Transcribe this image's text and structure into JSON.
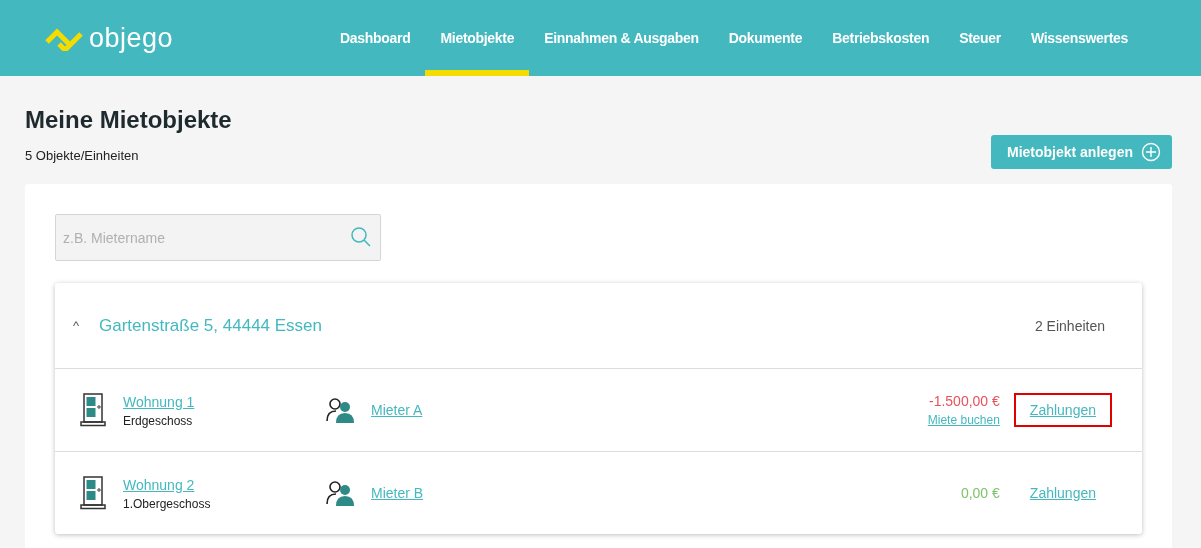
{
  "header": {
    "logo": "objego",
    "nav": [
      {
        "label": "Dashboard",
        "selected": false
      },
      {
        "label": "Mietobjekte",
        "selected": true
      },
      {
        "label": "Einnahmen & Ausgaben",
        "selected": false
      },
      {
        "label": "Dokumente",
        "selected": false
      },
      {
        "label": "Betriebskosten",
        "selected": false
      },
      {
        "label": "Steuer",
        "selected": false
      },
      {
        "label": "Wissenswertes",
        "selected": false
      }
    ]
  },
  "page": {
    "title": "Meine Mietobjekte",
    "subtitle": "5 Objekte/Einheiten",
    "add_button": "Mietobjekt anlegen"
  },
  "search": {
    "placeholder": "z.B. Mietername"
  },
  "property": {
    "expander": "^",
    "address": "Gartenstraße 5, 44444 Essen",
    "units_count": "2 Einheiten",
    "expanded": true,
    "units": [
      {
        "name": "Wohnung 1",
        "floor": "Erdgeschoss",
        "tenant": "Mieter A",
        "balance": "-1.500,00 €",
        "color": "#e8505b",
        "action": "Miete buchen",
        "payments": "Zahlungen",
        "highlighted": true
      },
      {
        "name": "Wohnung 2",
        "floor": "1.Obergeschoss",
        "tenant": "Mieter B",
        "balance": "0,00 €",
        "color": "#7cc36a",
        "payments": "Zahlungen",
        "highlighted": false
      }
    ]
  }
}
